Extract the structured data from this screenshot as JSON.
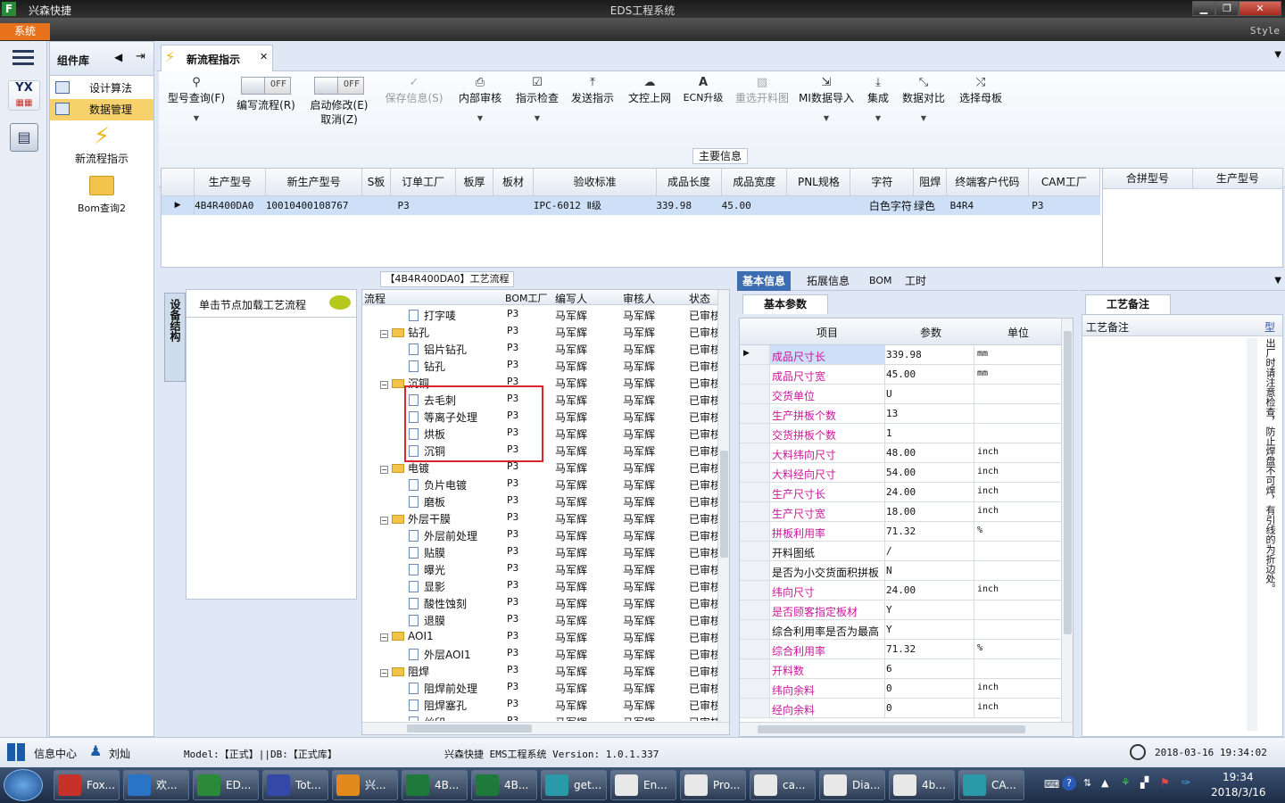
{
  "window": {
    "app_name": "兴森快捷",
    "title": "EDS工程系统",
    "logo": "F"
  },
  "menubar": {
    "system": "系统",
    "style": "Style"
  },
  "sidebar": {
    "header": "组件库",
    "items": [
      {
        "label": "设计算法"
      },
      {
        "label": "数据管理"
      }
    ],
    "tiles": [
      {
        "label": "新流程指示"
      },
      {
        "label": "Bom查询2"
      }
    ]
  },
  "tabs": [
    {
      "label": "新流程指示"
    }
  ],
  "toolbar": {
    "buttons": [
      {
        "label": "型号查询(F)",
        "icon": "search-icon"
      },
      {
        "label": "编写流程(R)",
        "toggle": "OFF"
      },
      {
        "label": "启动修改(E)",
        "label2": "取消(Z)",
        "toggle": "OFF"
      },
      {
        "label": "保存信息(S)",
        "icon": "check-icon",
        "disabled": true
      },
      {
        "label": "内部审核",
        "icon": "print-icon"
      },
      {
        "label": "指示检查",
        "icon": "checkbox-icon"
      },
      {
        "label": "发送指示",
        "icon": "upload-icon"
      },
      {
        "label": "文控上网",
        "icon": "cloud-upload-icon"
      },
      {
        "label": "ECN升级",
        "icon": "font-icon"
      },
      {
        "label": "重选开料图",
        "icon": "image-icon",
        "disabled": true
      },
      {
        "label": "MI数据导入",
        "icon": "import-icon"
      },
      {
        "label": "集成",
        "icon": "download-icon"
      },
      {
        "label": "数据对比",
        "icon": "compress-icon"
      },
      {
        "label": "选择母板",
        "icon": "shuffle-icon"
      }
    ]
  },
  "main_info": {
    "title": "主要信息",
    "columns": [
      "生产型号",
      "新生产型号",
      "S板",
      "订单工厂",
      "板厚",
      "板材",
      "验收标准",
      "成品长度",
      "成品宽度",
      "PNL规格",
      "字符",
      "阻焊",
      "终端客户代码",
      "CAM工厂"
    ],
    "row": [
      "4B4R400DA0",
      "10010400108767",
      "",
      "P3",
      "",
      "",
      "IPC-6012 Ⅱ级",
      "339.98",
      "45.00",
      "",
      "白色字符",
      "绿色",
      "B4R4",
      "P3"
    ],
    "side_columns": [
      "合拼型号",
      "生产型号"
    ]
  },
  "process": {
    "title": "【4B4R400DA0】工艺流程",
    "side_tab": "设备结构",
    "node_hint": "单击节点加载工艺流程",
    "columns": [
      "流程",
      "BOM工厂",
      "编写人",
      "审核人",
      "状态"
    ],
    "rows": [
      {
        "name": "打字唛",
        "type": "doc",
        "bom": "P3",
        "writer": "马军辉",
        "reviewer": "马军辉",
        "status": "已审核"
      },
      {
        "name": "钻孔",
        "type": "folder",
        "bom": "P3",
        "writer": "马军辉",
        "reviewer": "马军辉",
        "status": "已审核"
      },
      {
        "name": "铝片钻孔",
        "type": "doc",
        "bom": "P3",
        "writer": "马军辉",
        "reviewer": "马军辉",
        "status": "已审核"
      },
      {
        "name": "钻孔",
        "type": "doc",
        "bom": "P3",
        "writer": "马军辉",
        "reviewer": "马军辉",
        "status": "已审核"
      },
      {
        "name": "沉铜",
        "type": "folder",
        "bom": "P3",
        "writer": "马军辉",
        "reviewer": "马军辉",
        "status": "已审核"
      },
      {
        "name": "去毛刺",
        "type": "doc",
        "bom": "P3",
        "writer": "马军辉",
        "reviewer": "马军辉",
        "status": "已审核"
      },
      {
        "name": "等离子处理",
        "type": "doc",
        "bom": "P3",
        "writer": "马军辉",
        "reviewer": "马军辉",
        "status": "已审核"
      },
      {
        "name": "烘板",
        "type": "doc",
        "bom": "P3",
        "writer": "马军辉",
        "reviewer": "马军辉",
        "status": "已审核"
      },
      {
        "name": "沉铜",
        "type": "doc",
        "bom": "P3",
        "writer": "马军辉",
        "reviewer": "马军辉",
        "status": "已审核"
      },
      {
        "name": "电镀",
        "type": "folder",
        "bom": "P3",
        "writer": "马军辉",
        "reviewer": "马军辉",
        "status": "已审核"
      },
      {
        "name": "负片电镀",
        "type": "doc",
        "bom": "P3",
        "writer": "马军辉",
        "reviewer": "马军辉",
        "status": "已审核"
      },
      {
        "name": "磨板",
        "type": "doc",
        "bom": "P3",
        "writer": "马军辉",
        "reviewer": "马军辉",
        "status": "已审核"
      },
      {
        "name": "外层干膜",
        "type": "folder",
        "bom": "P3",
        "writer": "马军辉",
        "reviewer": "马军辉",
        "status": "已审核"
      },
      {
        "name": "外层前处理",
        "type": "doc",
        "bom": "P3",
        "writer": "马军辉",
        "reviewer": "马军辉",
        "status": "已审核"
      },
      {
        "name": "贴膜",
        "type": "doc",
        "bom": "P3",
        "writer": "马军辉",
        "reviewer": "马军辉",
        "status": "已审核"
      },
      {
        "name": "曝光",
        "type": "doc",
        "bom": "P3",
        "writer": "马军辉",
        "reviewer": "马军辉",
        "status": "已审核"
      },
      {
        "name": "显影",
        "type": "doc",
        "bom": "P3",
        "writer": "马军辉",
        "reviewer": "马军辉",
        "status": "已审核"
      },
      {
        "name": "酸性蚀刻",
        "type": "doc",
        "bom": "P3",
        "writer": "马军辉",
        "reviewer": "马军辉",
        "status": "已审核"
      },
      {
        "name": "退膜",
        "type": "doc",
        "bom": "P3",
        "writer": "马军辉",
        "reviewer": "马军辉",
        "status": "已审核"
      },
      {
        "name": "AOI1",
        "type": "folder",
        "bom": "P3",
        "writer": "马军辉",
        "reviewer": "马军辉",
        "status": "已审核"
      },
      {
        "name": "外层AOI1",
        "type": "doc",
        "bom": "P3",
        "writer": "马军辉",
        "reviewer": "马军辉",
        "status": "已审核"
      },
      {
        "name": "阻焊",
        "type": "folder",
        "bom": "P3",
        "writer": "马军辉",
        "reviewer": "马军辉",
        "status": "已审核"
      },
      {
        "name": "阻焊前处理",
        "type": "doc",
        "bom": "P3",
        "writer": "马军辉",
        "reviewer": "马军辉",
        "status": "已审核"
      },
      {
        "name": "阻焊塞孔",
        "type": "doc",
        "bom": "P3",
        "writer": "马军辉",
        "reviewer": "马军辉",
        "status": "已审核"
      },
      {
        "name": "丝印",
        "type": "doc",
        "bom": "P3",
        "writer": "马军辉",
        "reviewer": "马军辉",
        "status": "已审核"
      }
    ]
  },
  "info_tabs": [
    "基本信息",
    "拓展信息",
    "BOM",
    "工时"
  ],
  "basic_params": {
    "title": "基本参数",
    "columns": [
      "项目",
      "参数",
      "单位"
    ],
    "rows": [
      {
        "item": "成品尺寸长",
        "value": "339.98",
        "unit": "mm",
        "pink": true
      },
      {
        "item": "成品尺寸宽",
        "value": "45.00",
        "unit": "mm",
        "pink": true
      },
      {
        "item": "交货单位",
        "value": "U",
        "unit": "",
        "pink": true
      },
      {
        "item": "生产拼板个数",
        "value": "13",
        "unit": "",
        "pink": true
      },
      {
        "item": "交货拼板个数",
        "value": "1",
        "unit": "",
        "pink": true
      },
      {
        "item": "大料纬向尺寸",
        "value": "48.00",
        "unit": "inch",
        "pink": true
      },
      {
        "item": "大料经向尺寸",
        "value": "54.00",
        "unit": "inch",
        "pink": true
      },
      {
        "item": "生产尺寸长",
        "value": "24.00",
        "unit": "inch",
        "pink": true
      },
      {
        "item": "生产尺寸宽",
        "value": "18.00",
        "unit": "inch",
        "pink": true
      },
      {
        "item": "拼板利用率",
        "value": "71.32",
        "unit": "%",
        "pink": true
      },
      {
        "item": "开料图纸",
        "value": "/",
        "unit": "",
        "pink": false
      },
      {
        "item": "是否为小交货面积拼板",
        "value": "N",
        "unit": "",
        "pink": false
      },
      {
        "item": "纬向尺寸",
        "value": "24.00",
        "unit": "inch",
        "pink": true
      },
      {
        "item": "是否顾客指定板材",
        "value": "Y",
        "unit": "",
        "pink": true
      },
      {
        "item": "综合利用率是否为最高",
        "value": "Y",
        "unit": "",
        "pink": false
      },
      {
        "item": "综合利用率",
        "value": "71.32",
        "unit": "%",
        "pink": true
      },
      {
        "item": "开料数",
        "value": "6",
        "unit": "",
        "pink": true
      },
      {
        "item": "纬向余料",
        "value": "0",
        "unit": "inch",
        "pink": true
      },
      {
        "item": "经向余料",
        "value": "0",
        "unit": "inch",
        "pink": true
      }
    ]
  },
  "notes": {
    "tab": "工艺备注",
    "column": "工艺备注",
    "column2": "型",
    "text": "出厂时请注意检查，防止焊盘不可焊，有引线的为折边处。"
  },
  "status": {
    "info_center": "信息中心",
    "user": "刘灿",
    "model": "Model:【正式】||DB:【正式库】",
    "version": "兴森快捷 EMS工程系统 Version: 1.0.1.337",
    "datetime": "2018-03-16 19:34:02"
  },
  "taskbar": {
    "items": [
      {
        "label": "Fox...",
        "color": "#c8302a"
      },
      {
        "label": "欢...",
        "color": "#2a74c8"
      },
      {
        "label": "ED...",
        "color": "#2a8a3a"
      },
      {
        "label": "Tot...",
        "color": "#3448a8"
      },
      {
        "label": "兴...",
        "color": "#e08a1c"
      },
      {
        "label": "4B...",
        "color": "#1e7a3a"
      },
      {
        "label": "4B...",
        "color": "#1e7a3a"
      },
      {
        "label": "get...",
        "color": "#2a9aa8"
      },
      {
        "label": "En...",
        "color": "#e8e8e8"
      },
      {
        "label": "Pro...",
        "color": "#e8e8e8"
      },
      {
        "label": "ca...",
        "color": "#e8e8e8"
      },
      {
        "label": "Dia...",
        "color": "#e8e8e8"
      },
      {
        "label": "4b...",
        "color": "#e8e8e8"
      },
      {
        "label": "CA...",
        "color": "#2a9aa8"
      }
    ],
    "clock_time": "19:34",
    "clock_date": "2018/3/16"
  }
}
